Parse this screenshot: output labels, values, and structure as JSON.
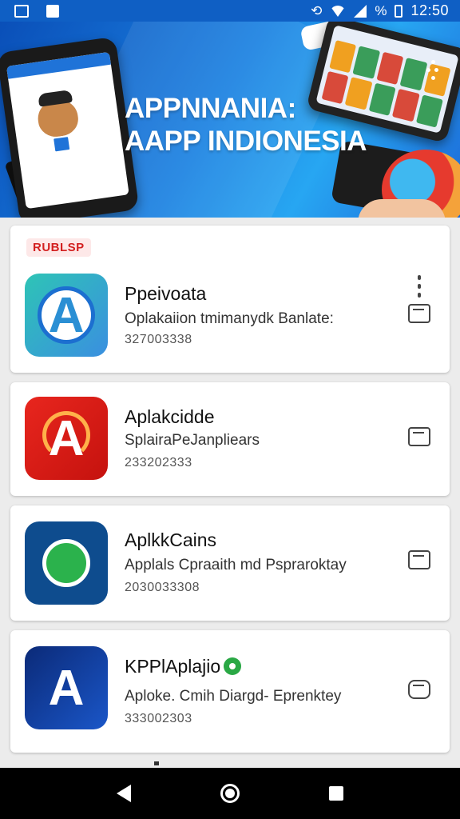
{
  "status_bar": {
    "time": "12:50",
    "battery_text": "%"
  },
  "banner": {
    "title_line1": "APPNNANIA:",
    "title_line2": "AAPP INDIONESIA",
    "pager_count": 3,
    "pager_active_index": 0
  },
  "apps": [
    {
      "tag": "RUBLSP",
      "name": "Ppeivoata",
      "description": "Oplakaiion tmimanydk Banlate:",
      "stats": "327003338",
      "icon": "app-a-teal-icon",
      "action_icon": "install-icon"
    },
    {
      "name": "Aplakcidde",
      "description": "SplairaPeJanpliears",
      "stats": "233202333",
      "icon": "app-a-red-icon",
      "action_icon": "install-icon"
    },
    {
      "name": "AplkkCains",
      "description": "Applals Cpraaith md Pspraroktay",
      "stats": "2030033308",
      "icon": "app-chat-green-icon",
      "action_icon": "install-icon"
    },
    {
      "name": "KPPlAplajio",
      "description": "Aploke. Cmih Diargd- Eprenktey",
      "stats": "333002303",
      "icon": "app-a-navy-icon",
      "verified": true,
      "action_icon": "install-icon"
    }
  ],
  "colors": {
    "status_bar": "#0f5fc4",
    "banner_start": "#0a4fb8",
    "banner_end": "#27a6f2",
    "tag_text": "#d32020",
    "verified": "#2aa845"
  }
}
